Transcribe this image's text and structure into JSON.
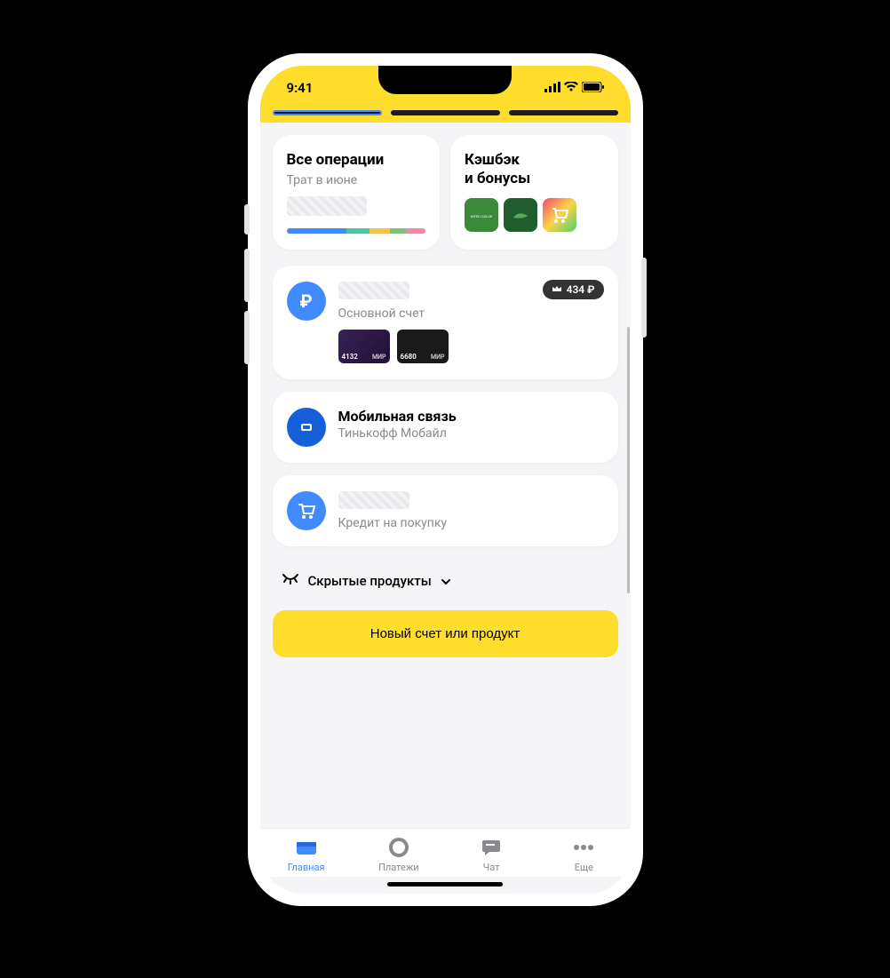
{
  "status": {
    "time": "9:41"
  },
  "operations": {
    "title": "Все операции",
    "subtitle": "Трат в июне"
  },
  "cashback": {
    "title_line1": "Кэшбэк",
    "title_line2": "и бонусы"
  },
  "accounts": {
    "main": {
      "subtitle": "Основной счет",
      "badge_value": "434 ₽",
      "card1_last4": "4132",
      "card1_system": "МИР",
      "card2_last4": "6680",
      "card2_system": "МИР"
    },
    "mobile": {
      "title": "Мобильная связь",
      "subtitle": "Тинькофф Мобайл"
    },
    "credit": {
      "subtitle": "Кредит на покупку"
    }
  },
  "hidden_products_label": "Скрытые продукты",
  "cta_label": "Новый счет или продукт",
  "tabs": {
    "home": "Главная",
    "payments": "Платежи",
    "chat": "Чат",
    "more": "Еще"
  }
}
